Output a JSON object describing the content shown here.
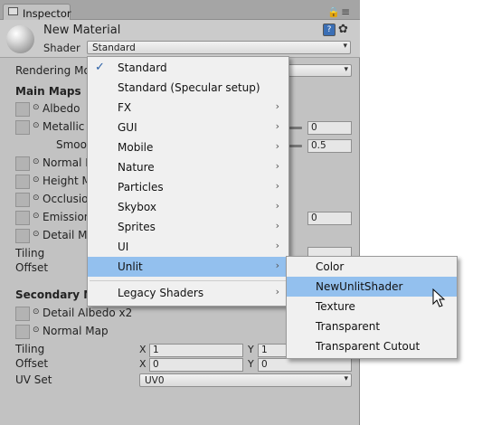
{
  "tab": {
    "title": "Inspector"
  },
  "material": {
    "name": "New Material",
    "shader_label": "Shader",
    "shader_value": "Standard"
  },
  "left_labels": {
    "rendering_mode": "Rendering Mo",
    "main_maps": "Main Maps",
    "albedo": "Albedo",
    "metallic": "Metallic",
    "smoothness": "Smoo",
    "normal_map": "Normal M",
    "height_map": "Height M",
    "occlusion": "Occlusio",
    "emission": "Emission",
    "detail_mask": "Detail Ma",
    "tiling": "Tiling",
    "offset": "Offset",
    "secondary_maps": "Secondary M",
    "detail_albedo": "Detail Albedo x2",
    "normal_map2": "Normal Map",
    "tiling2": "Tiling",
    "offset2": "Offset",
    "uv_set": "UV Set"
  },
  "values": {
    "metallic": "0",
    "smoothness": "0.5",
    "emission": "0",
    "tiling2_x": "1",
    "tiling2_y": "1",
    "offset2_x": "0",
    "offset2_y": "0",
    "uv_set": "UV0",
    "axis_x": "X",
    "axis_y": "Y"
  },
  "shader_menu": [
    {
      "label": "Standard",
      "checked": true,
      "submenu": false
    },
    {
      "label": "Standard (Specular setup)",
      "submenu": false
    },
    {
      "label": "FX",
      "submenu": true
    },
    {
      "label": "GUI",
      "submenu": true
    },
    {
      "label": "Mobile",
      "submenu": true
    },
    {
      "label": "Nature",
      "submenu": true
    },
    {
      "label": "Particles",
      "submenu": true
    },
    {
      "label": "Skybox",
      "submenu": true
    },
    {
      "label": "Sprites",
      "submenu": true
    },
    {
      "label": "UI",
      "submenu": true
    },
    {
      "label": "Unlit",
      "submenu": true,
      "highlighted": true
    },
    {
      "label": "Legacy Shaders",
      "submenu": true
    }
  ],
  "unlit_submenu": [
    {
      "label": "Color"
    },
    {
      "label": "NewUnlitShader",
      "highlighted": true
    },
    {
      "label": "Texture"
    },
    {
      "label": "Transparent"
    },
    {
      "label": "Transparent Cutout"
    }
  ],
  "glyphs": {
    "check": "✓",
    "arrow": "›",
    "dropdown": "▾",
    "lock": "🔒",
    "menu": "≡",
    "gear": "✿",
    "circle": "⊙"
  },
  "colors": {
    "highlight": "#93c0ee",
    "panel": "#c2c2c2",
    "menu_bg": "#f0f0f0"
  }
}
